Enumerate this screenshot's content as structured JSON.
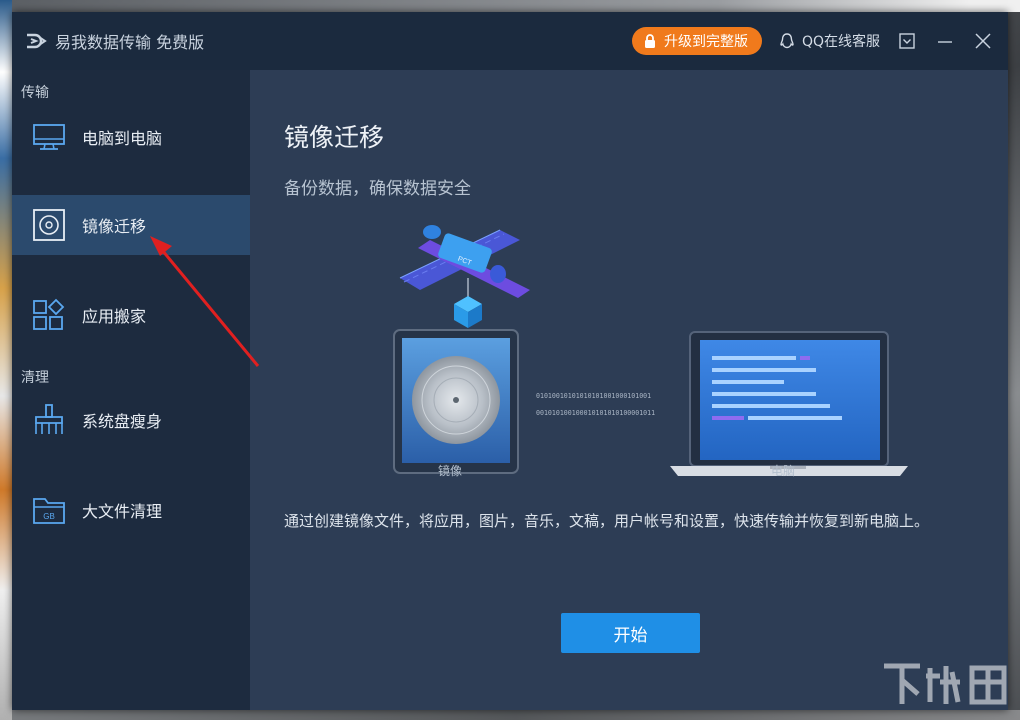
{
  "window": {
    "app_title": "易我数据传输 免费版",
    "upgrade_label": "升级到完整版",
    "support_label": "QQ在线客服"
  },
  "sidebar": {
    "section_transfer": "传输",
    "section_clean": "清理",
    "items": [
      {
        "label": "电脑到电脑",
        "icon": "monitor-icon",
        "active": false
      },
      {
        "label": "镜像迁移",
        "icon": "disc-icon",
        "active": true
      },
      {
        "label": "应用搬家",
        "icon": "apps-grid-icon",
        "active": false
      },
      {
        "label": "系统盘瘦身",
        "icon": "broom-icon",
        "active": false
      },
      {
        "label": "大文件清理",
        "icon": "gb-folder-icon",
        "active": false
      }
    ]
  },
  "main": {
    "title": "镜像迁移",
    "subtitle": "备份数据，确保数据安全",
    "illustration": {
      "binary_line_1": "01010010101010101001000101001",
      "binary_line_2": "001010100100010101010100001011",
      "satellite_tag": "PCT",
      "caption_mirror": "镜像",
      "caption_pc": "电脑"
    },
    "description": "通过创建镜像文件，将应用，图片，音乐，文稿，用户帐号和设置，快速传输并恢复到新电脑上。",
    "start_label": "开始"
  },
  "colors": {
    "accent_orange": "#f07a1c",
    "start_blue": "#1f8fe6",
    "active_item": "#2b4a6d",
    "sidebar_bg": "#1d2b3f",
    "main_bg": "#2d3d55",
    "annotation_red": "#e02020"
  }
}
